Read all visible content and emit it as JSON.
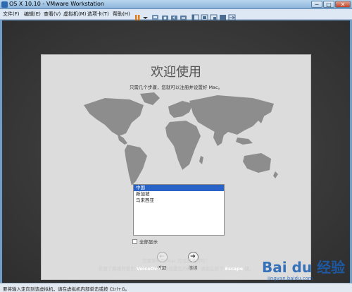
{
  "window": {
    "title": "OS X 10.10 - VMware Workstation",
    "buttons": {
      "minimize": "─",
      "maximize": "□",
      "close": "✕"
    }
  },
  "menubar": {
    "items": [
      "文件(F)",
      "编辑(E)",
      "查看(V)",
      "虚拟机(M)",
      "选项卡(T)",
      "帮助(H)"
    ]
  },
  "setup": {
    "title": "欢迎使用",
    "subtitle": "只需几个步骤，您就可以注册并设置好 Mac。",
    "countries": [
      "中国",
      "新加坡",
      "马来西亚"
    ],
    "selected_index": 0,
    "show_all_label": "全部显示",
    "back_label": "返回",
    "continue_label": "继续",
    "back_glyph": "←",
    "continue_glyph": "➔",
    "voiceover_line1": "您需要听取 Mac 的设置说明吗？",
    "voiceover_line2_pre": "若要了解如何使用",
    "voiceover_line2_vo": "VoiceOver",
    "voiceover_line2_mid": "来设置您的电脑，请现在按下",
    "voiceover_line2_key": "Escape",
    "voiceover_line2_post": "键。"
  },
  "statusbar": {
    "text": "要将输入定向到该虚拟机，请在虚拟机内部单击或按 Ctrl+G。"
  },
  "watermark": {
    "logo": "Bai du 经验",
    "url": "jingyan.baidu.com"
  },
  "colors": {
    "accent": "#2a63c7",
    "titlebar": "#8db6dc",
    "panel": "#dcdcdc",
    "vm_bg": "#3a3a3a"
  }
}
